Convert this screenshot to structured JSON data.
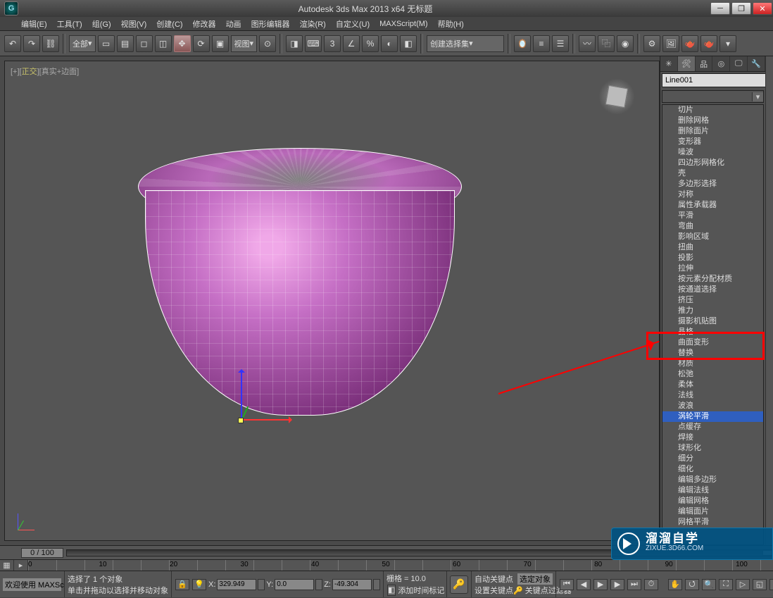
{
  "title": "Autodesk 3ds Max  2013 x64     无标题",
  "menus": [
    "编辑(E)",
    "工具(T)",
    "组(G)",
    "视图(V)",
    "创建(C)",
    "修改器",
    "动画",
    "图形编辑器",
    "渲染(R)",
    "自定义(U)",
    "MAXScript(M)",
    "帮助(H)"
  ],
  "toolbar": {
    "sel_filter": "全部",
    "ref_sys": "视图",
    "named_sel": "创建选择集"
  },
  "viewport": {
    "label_prefix": "[+][",
    "label_view": "正交",
    "label_suffix": "][真实+边面]"
  },
  "object_name": "Line001",
  "modifiers": [
    "切片",
    "删除网格",
    "删除面片",
    "变形器",
    "噪波",
    "四边形网格化",
    "壳",
    "多边形选择",
    "对称",
    "属性承载器",
    "平滑",
    "弯曲",
    "影响区域",
    "扭曲",
    "投影",
    "拉伸",
    "按元素分配材质",
    "按通道选择",
    "挤压",
    "推力",
    "摄影机贴图",
    "晶格",
    "曲面变形",
    "替换",
    "材质",
    "松弛",
    "柔体",
    "法线",
    "波浪",
    "涡轮平滑",
    "点缓存",
    "焊接",
    "球形化",
    "细分",
    "细化",
    "编辑多边形",
    "编辑法线",
    "编辑网格",
    "编辑面片",
    "网格平滑"
  ],
  "modifier_selected_index": 29,
  "timeline": {
    "pos": "0 / 100",
    "ticks": [
      "0",
      "10",
      "20",
      "30",
      "40",
      "50",
      "60",
      "70",
      "80",
      "90",
      "100"
    ]
  },
  "status": {
    "selected": "选择了 1 个对象",
    "prompt": "单击并拖动以选择并移动对象",
    "welcome": "欢迎使用  MAXSc",
    "x": "329.949",
    "y": "0.0",
    "z": "-49.304",
    "grid": "栅格 = 10.0",
    "addtag": "添加时间标记",
    "autokey": "自动关键点",
    "setkey": "设置关键点",
    "selobj": "选定对象",
    "keyfilter": "关键点过滤器"
  },
  "watermark": {
    "cn": "溜溜自学",
    "domain": "ZIXUE.3D66.COM"
  }
}
